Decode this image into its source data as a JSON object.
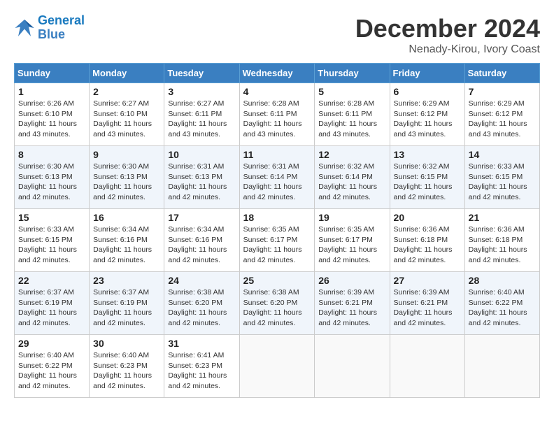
{
  "logo": {
    "line1": "General",
    "line2": "Blue"
  },
  "title": "December 2024",
  "location": "Nenady-Kirou, Ivory Coast",
  "days_header": [
    "Sunday",
    "Monday",
    "Tuesday",
    "Wednesday",
    "Thursday",
    "Friday",
    "Saturday"
  ],
  "weeks": [
    [
      {
        "day": "1",
        "sunrise": "6:26 AM",
        "sunset": "6:10 PM",
        "daylight": "11 hours and 43 minutes."
      },
      {
        "day": "2",
        "sunrise": "6:27 AM",
        "sunset": "6:10 PM",
        "daylight": "11 hours and 43 minutes."
      },
      {
        "day": "3",
        "sunrise": "6:27 AM",
        "sunset": "6:11 PM",
        "daylight": "11 hours and 43 minutes."
      },
      {
        "day": "4",
        "sunrise": "6:28 AM",
        "sunset": "6:11 PM",
        "daylight": "11 hours and 43 minutes."
      },
      {
        "day": "5",
        "sunrise": "6:28 AM",
        "sunset": "6:11 PM",
        "daylight": "11 hours and 43 minutes."
      },
      {
        "day": "6",
        "sunrise": "6:29 AM",
        "sunset": "6:12 PM",
        "daylight": "11 hours and 43 minutes."
      },
      {
        "day": "7",
        "sunrise": "6:29 AM",
        "sunset": "6:12 PM",
        "daylight": "11 hours and 43 minutes."
      }
    ],
    [
      {
        "day": "8",
        "sunrise": "6:30 AM",
        "sunset": "6:13 PM",
        "daylight": "11 hours and 42 minutes."
      },
      {
        "day": "9",
        "sunrise": "6:30 AM",
        "sunset": "6:13 PM",
        "daylight": "11 hours and 42 minutes."
      },
      {
        "day": "10",
        "sunrise": "6:31 AM",
        "sunset": "6:13 PM",
        "daylight": "11 hours and 42 minutes."
      },
      {
        "day": "11",
        "sunrise": "6:31 AM",
        "sunset": "6:14 PM",
        "daylight": "11 hours and 42 minutes."
      },
      {
        "day": "12",
        "sunrise": "6:32 AM",
        "sunset": "6:14 PM",
        "daylight": "11 hours and 42 minutes."
      },
      {
        "day": "13",
        "sunrise": "6:32 AM",
        "sunset": "6:15 PM",
        "daylight": "11 hours and 42 minutes."
      },
      {
        "day": "14",
        "sunrise": "6:33 AM",
        "sunset": "6:15 PM",
        "daylight": "11 hours and 42 minutes."
      }
    ],
    [
      {
        "day": "15",
        "sunrise": "6:33 AM",
        "sunset": "6:15 PM",
        "daylight": "11 hours and 42 minutes."
      },
      {
        "day": "16",
        "sunrise": "6:34 AM",
        "sunset": "6:16 PM",
        "daylight": "11 hours and 42 minutes."
      },
      {
        "day": "17",
        "sunrise": "6:34 AM",
        "sunset": "6:16 PM",
        "daylight": "11 hours and 42 minutes."
      },
      {
        "day": "18",
        "sunrise": "6:35 AM",
        "sunset": "6:17 PM",
        "daylight": "11 hours and 42 minutes."
      },
      {
        "day": "19",
        "sunrise": "6:35 AM",
        "sunset": "6:17 PM",
        "daylight": "11 hours and 42 minutes."
      },
      {
        "day": "20",
        "sunrise": "6:36 AM",
        "sunset": "6:18 PM",
        "daylight": "11 hours and 42 minutes."
      },
      {
        "day": "21",
        "sunrise": "6:36 AM",
        "sunset": "6:18 PM",
        "daylight": "11 hours and 42 minutes."
      }
    ],
    [
      {
        "day": "22",
        "sunrise": "6:37 AM",
        "sunset": "6:19 PM",
        "daylight": "11 hours and 42 minutes."
      },
      {
        "day": "23",
        "sunrise": "6:37 AM",
        "sunset": "6:19 PM",
        "daylight": "11 hours and 42 minutes."
      },
      {
        "day": "24",
        "sunrise": "6:38 AM",
        "sunset": "6:20 PM",
        "daylight": "11 hours and 42 minutes."
      },
      {
        "day": "25",
        "sunrise": "6:38 AM",
        "sunset": "6:20 PM",
        "daylight": "11 hours and 42 minutes."
      },
      {
        "day": "26",
        "sunrise": "6:39 AM",
        "sunset": "6:21 PM",
        "daylight": "11 hours and 42 minutes."
      },
      {
        "day": "27",
        "sunrise": "6:39 AM",
        "sunset": "6:21 PM",
        "daylight": "11 hours and 42 minutes."
      },
      {
        "day": "28",
        "sunrise": "6:40 AM",
        "sunset": "6:22 PM",
        "daylight": "11 hours and 42 minutes."
      }
    ],
    [
      {
        "day": "29",
        "sunrise": "6:40 AM",
        "sunset": "6:22 PM",
        "daylight": "11 hours and 42 minutes."
      },
      {
        "day": "30",
        "sunrise": "6:40 AM",
        "sunset": "6:23 PM",
        "daylight": "11 hours and 42 minutes."
      },
      {
        "day": "31",
        "sunrise": "6:41 AM",
        "sunset": "6:23 PM",
        "daylight": "11 hours and 42 minutes."
      },
      null,
      null,
      null,
      null
    ]
  ]
}
